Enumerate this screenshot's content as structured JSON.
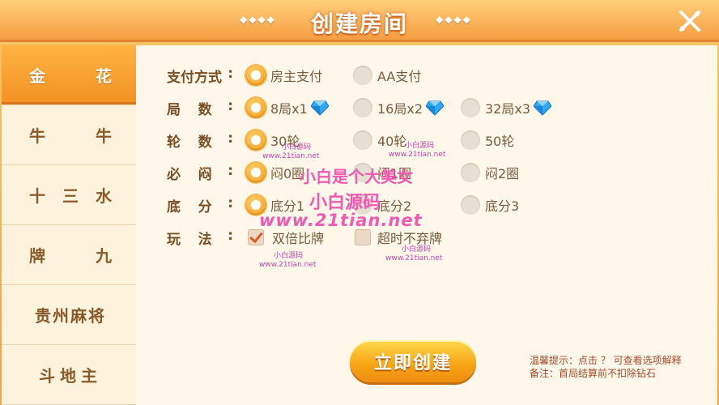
{
  "header": {
    "title": "创建房间",
    "deco_left": "◆◆◆◆",
    "deco_right": "◆◆◆◆"
  },
  "sidebar": {
    "items": [
      {
        "a": "金",
        "b": "花",
        "active": true
      },
      {
        "a": "牛",
        "b": "牛"
      },
      {
        "a": "十",
        "mid": "三",
        "b": "水"
      },
      {
        "a": "牌",
        "b": "九"
      },
      {
        "label": "贵州麻将"
      },
      {
        "label": "斗地主"
      }
    ]
  },
  "form": {
    "pay": {
      "label_a": "支付方式",
      "colon": ":",
      "opts": [
        "房主支付",
        "AA支付"
      ]
    },
    "rounds": {
      "label_a": "局",
      "label_b": "数",
      "colon": ":",
      "opts": [
        "8局x1",
        "16局x2",
        "32局x3"
      ]
    },
    "turns": {
      "label_a": "轮",
      "label_b": "数",
      "colon": ":",
      "opts": [
        "30轮",
        "40轮",
        "50轮"
      ]
    },
    "blind": {
      "label_a": "必",
      "label_b": "闷",
      "colon": ":",
      "opts": [
        "闷0圈",
        "闷1圈",
        "闷2圈"
      ]
    },
    "base": {
      "label_a": "底",
      "label_b": "分",
      "colon": ":",
      "opts": [
        "底分1",
        "底分2",
        "底分3"
      ]
    },
    "rules": {
      "label_a": "玩",
      "label_b": "法",
      "colon": ":",
      "opts": [
        "双倍比牌",
        "超时不弃牌"
      ]
    }
  },
  "watermarks": {
    "big1": "小白是个大美女",
    "big2": "小白源码",
    "big3": "www.21tian.net",
    "small_name": "小白源码",
    "small_url": "www.21tian.net"
  },
  "create_button": "立即创建",
  "tips": {
    "line1": "温馨提示：点击 ？ 可查看选项解释",
    "line2": "备注：首局结算前不扣除钻石"
  },
  "colors": {
    "accent": "#f39a1e",
    "gem": "#2fa8f0",
    "watermark": "#f15ab1"
  }
}
